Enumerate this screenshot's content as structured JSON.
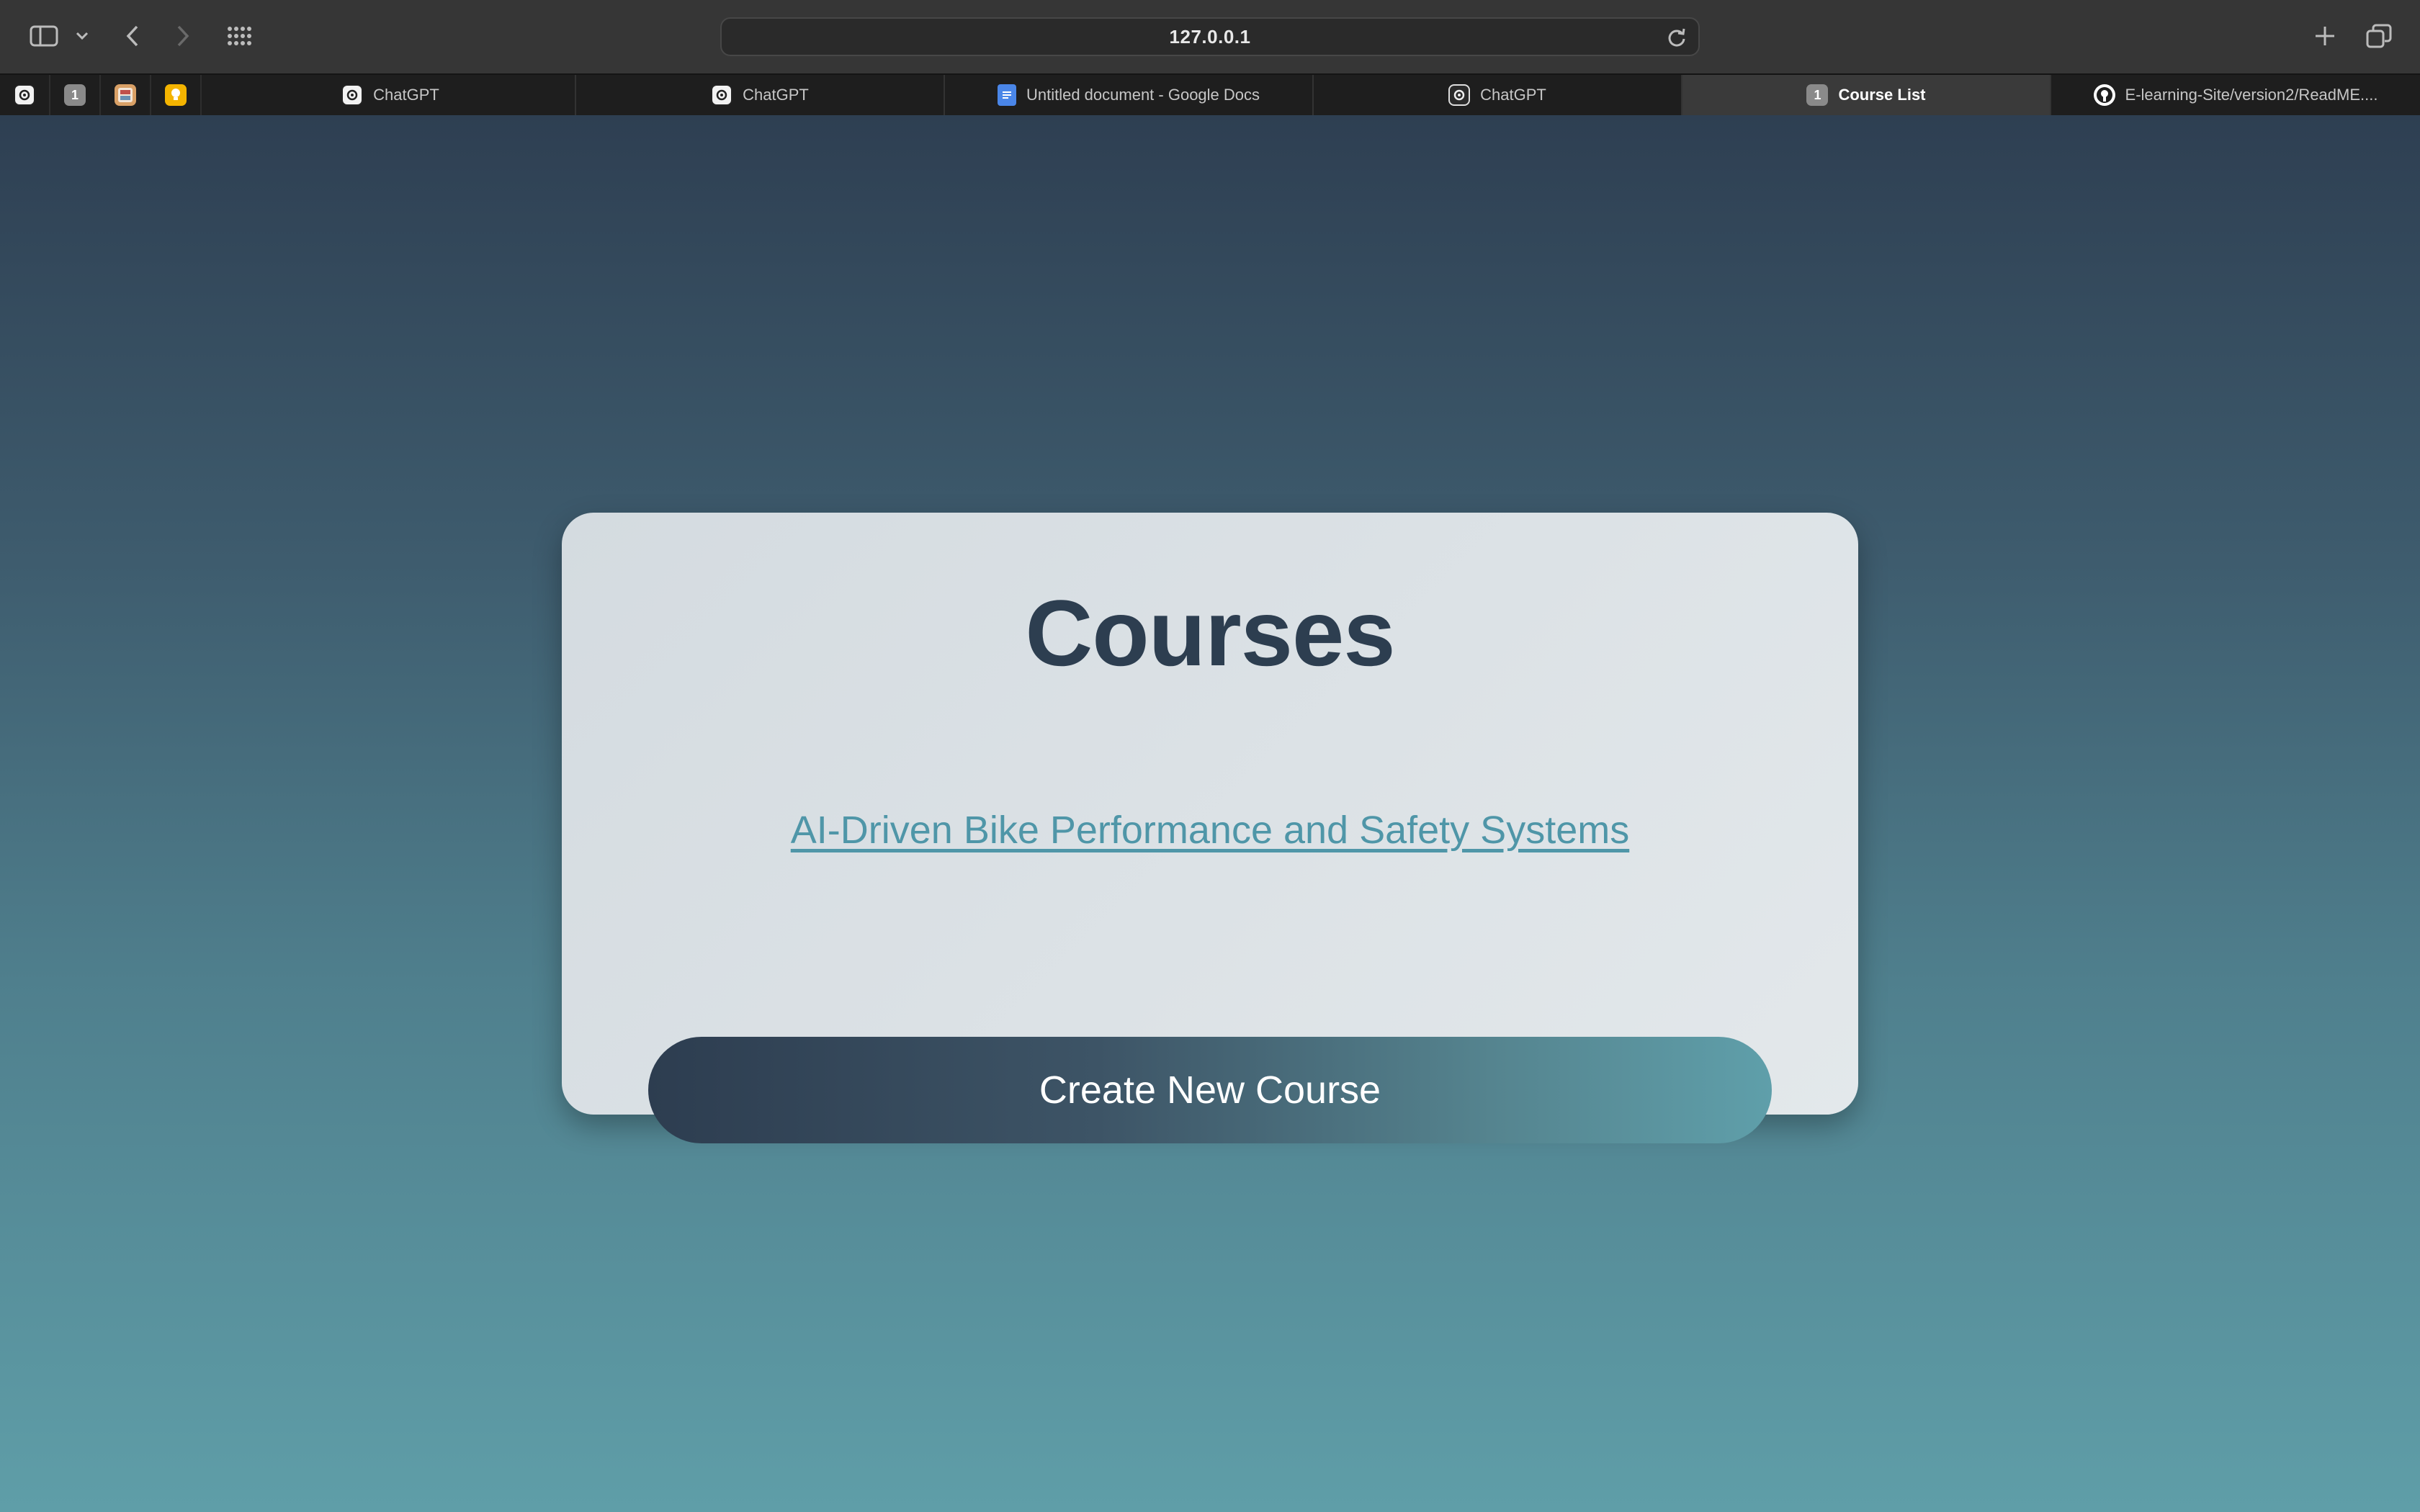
{
  "browser": {
    "url": "127.0.0.1",
    "pinned_tabs": [
      {
        "icon": "chatgpt-icon"
      },
      {
        "icon": "number-one-icon",
        "badge": "1"
      },
      {
        "icon": "image-icon"
      },
      {
        "icon": "lightbulb-icon"
      }
    ],
    "tabs": [
      {
        "title": "ChatGPT",
        "icon": "chatgpt-icon"
      },
      {
        "title": "ChatGPT",
        "icon": "chatgpt-icon"
      },
      {
        "title": "Untitled document - Google Docs",
        "icon": "google-docs-icon"
      },
      {
        "title": "ChatGPT",
        "icon": "chatgpt-icon"
      },
      {
        "title": "Course List",
        "icon": "number-one-icon",
        "badge": "1",
        "active": true
      },
      {
        "title": "E-learning-Site/version2/ReadME....",
        "icon": "github-icon"
      }
    ]
  },
  "page": {
    "title": "Courses",
    "courses": [
      "AI-Driven Bike Performance and Safety Systems"
    ],
    "create_button_label": "Create New Course"
  },
  "colors": {
    "heading": "#2d3e50",
    "link": "#4f96a8",
    "gradient_top": "#2e3f52",
    "gradient_bottom": "#5f9ea8"
  }
}
